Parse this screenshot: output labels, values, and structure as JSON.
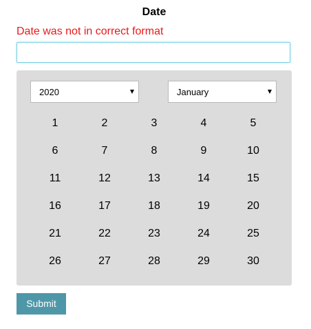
{
  "title": "Date",
  "error_message": "Date was not in correct format",
  "date_input": {
    "value": "",
    "placeholder": ""
  },
  "calendar": {
    "year_select": {
      "selected": "2020"
    },
    "month_select": {
      "selected": "January"
    },
    "days": [
      "1",
      "2",
      "3",
      "4",
      "5",
      "6",
      "7",
      "8",
      "9",
      "10",
      "11",
      "12",
      "13",
      "14",
      "15",
      "16",
      "17",
      "18",
      "19",
      "20",
      "21",
      "22",
      "23",
      "24",
      "25",
      "26",
      "27",
      "28",
      "29",
      "30"
    ]
  },
  "submit_label": "Submit",
  "colors": {
    "error": "#e8191b",
    "calendar_bg": "#dcdcdc",
    "submit_bg": "#4e97a8",
    "input_focus_border": "#7ecfe3"
  }
}
